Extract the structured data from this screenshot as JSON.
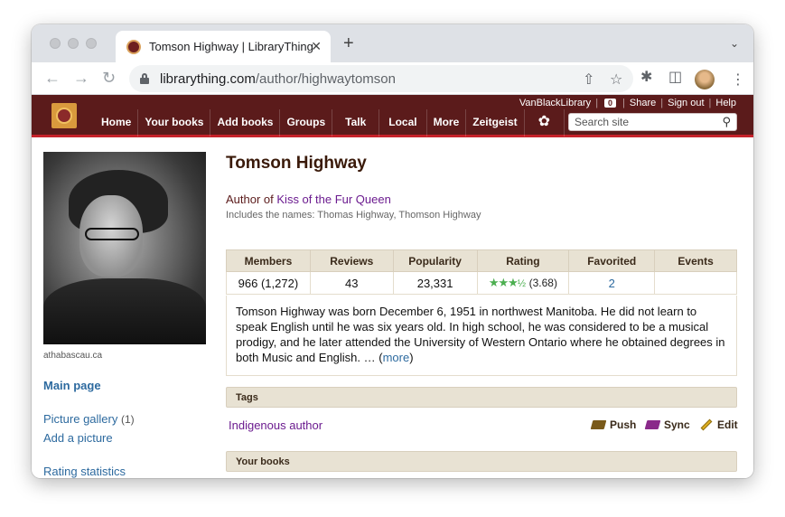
{
  "browser": {
    "tab_title": "Tomson Highway | LibraryThing",
    "tab_close": "✕",
    "new_tab": "+",
    "url_domain": "librarything.com",
    "url_path": "/author/highwaytomson"
  },
  "site": {
    "nav": [
      "Home",
      "Your books",
      "Add books",
      "Groups",
      "Talk",
      "Local",
      "More",
      "Zeitgeist"
    ],
    "user": "VanBlackLibrary",
    "message_count": "0",
    "share": "Share",
    "signout": "Sign out",
    "help": "Help",
    "search_placeholder": "Search site"
  },
  "sidebar": {
    "photo_credit": "athabascau.ca",
    "main_page": "Main page",
    "picture_gallery": "Picture gallery",
    "picture_count": "(1)",
    "add_picture": "Add a picture",
    "rating_statistics": "Rating statistics"
  },
  "author": {
    "name": "Tomson Highway",
    "author_of_prefix": "Author of",
    "book": "Kiss of the Fur Queen",
    "names_line": "Includes the names: Thomas Highway, Thomson Highway"
  },
  "stats": {
    "headers": [
      "Members",
      "Reviews",
      "Popularity",
      "Rating",
      "Favorited",
      "Events"
    ],
    "members": "966 (1,272)",
    "reviews": "43",
    "popularity": "23,331",
    "rating": "(3.68)",
    "rating_value": 3.5,
    "favorited": "2",
    "events": ""
  },
  "bio": {
    "text": "Tomson Highway was born December 6, 1951 in northwest Manitoba. He did not learn to speak English until he was six years old. In high school, he was considered to be a musical prodigy, and he later attended the University of Western Ontario where he obtained degrees in both Music and English. … (",
    "more": "more",
    "close": ")"
  },
  "tags": {
    "title": "Tags",
    "tag": "Indigenous author",
    "push": "Push",
    "sync": "Sync",
    "edit": "Edit"
  },
  "your_books": {
    "title": "Your books"
  }
}
